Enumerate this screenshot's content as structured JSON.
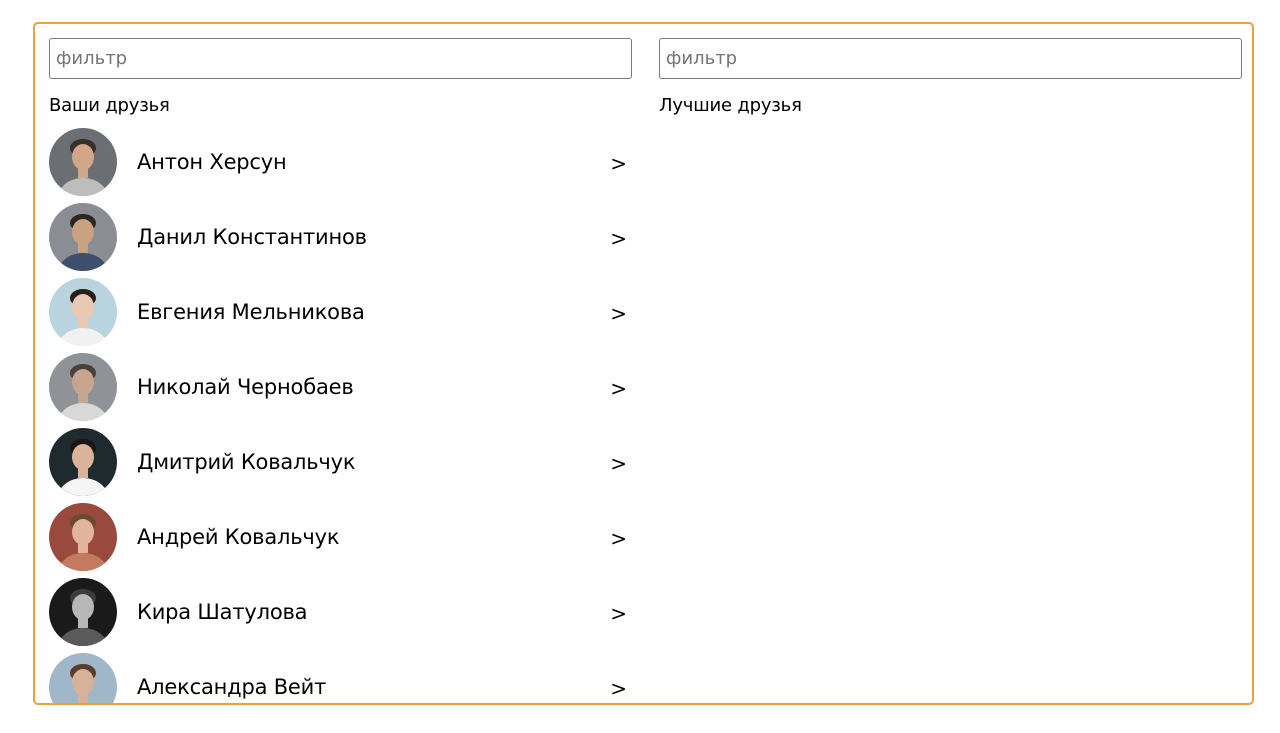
{
  "left_panel": {
    "filter_placeholder": "фильтр",
    "title": "Ваши друзья",
    "friends": [
      {
        "name": "Антон Херсун",
        "action": ">",
        "avatar": {
          "bg": "#6b6f74",
          "skin": "#d2a688",
          "hair": "#3a2e28",
          "shirt": "#bdbdbd"
        }
      },
      {
        "name": "Данил Константинов",
        "action": ">",
        "avatar": {
          "bg": "#8a8e94",
          "skin": "#c9a183",
          "hair": "#2c2723",
          "shirt": "#3d4f6b"
        }
      },
      {
        "name": "Евгения Мельникова",
        "action": ">",
        "avatar": {
          "bg": "#b9d3df",
          "skin": "#eac9b4",
          "hair": "#2a1e1a",
          "shirt": "#f1f1f1"
        }
      },
      {
        "name": "Николай Чернобаев",
        "action": ">",
        "avatar": {
          "bg": "#8f9297",
          "skin": "#c7a58e",
          "hair": "#4a413a",
          "shirt": "#d8d8d8"
        }
      },
      {
        "name": "Дмитрий Ковальчук",
        "action": ">",
        "avatar": {
          "bg": "#1f2a2e",
          "skin": "#d9b49a",
          "hair": "#1c1715",
          "shirt": "#f5f5f5"
        }
      },
      {
        "name": "Андрей Ковальчук",
        "action": ">",
        "avatar": {
          "bg": "#9a4a3c",
          "skin": "#e2b49c",
          "hair": "#6b4a33",
          "shirt": "#c47a5e"
        }
      },
      {
        "name": "Кира Шатулова",
        "action": ">",
        "avatar": {
          "bg": "#1a1a1a",
          "skin": "#b7b7b7",
          "hair": "#3c3c3c",
          "shirt": "#5a5a5a"
        }
      },
      {
        "name": "Александра Вейт",
        "action": ">",
        "avatar": {
          "bg": "#9fb7c9",
          "skin": "#d6b29a",
          "hair": "#5a3d2b",
          "shirt": "#d9333f"
        }
      }
    ]
  },
  "right_panel": {
    "filter_placeholder": "фильтр",
    "title": "Лучшие друзья",
    "friends": []
  },
  "colors": {
    "frame_border": "#e8a33d",
    "input_border": "#7a7a7a",
    "placeholder": "#757575"
  }
}
